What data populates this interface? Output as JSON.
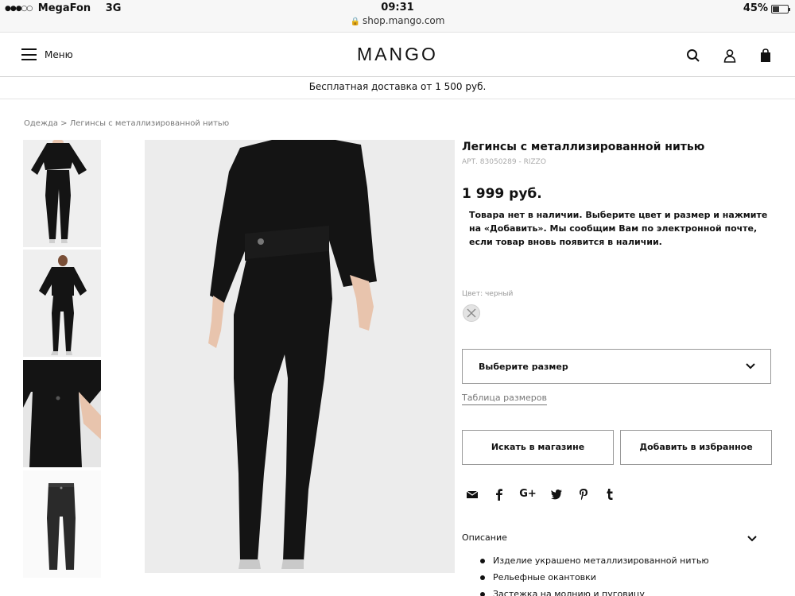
{
  "status_bar": {
    "carrier": "MegaFon",
    "network": "3G",
    "time": "09:31",
    "url": "shop.mango.com",
    "battery": "45%",
    "battery_level": 0.45
  },
  "header": {
    "menu_label": "Меню",
    "logo": "MANGO",
    "icons": [
      "search-icon",
      "user-icon",
      "bag-icon"
    ]
  },
  "promo": "Бесплатная доставка от 1 500 руб.",
  "breadcrumb": "Одежда > Легинсы с металлизированной нитью",
  "product": {
    "title": "Легинсы с металлизированной нитью",
    "ref": "АРТ. 83050289 - RIZZO",
    "price": "1 999 руб.",
    "stock_message": "Товара нет в наличии. Выберите цвет и размер и нажмите на «Добавить». Мы сообщим Вам по электронной почте, если товар вновь появится в наличии.",
    "color_label": "Цвет: черный",
    "size_placeholder": "Выберите размер",
    "size_chart": "Таблица размеров",
    "find_in_store": "Искать в магазине",
    "add_to_favorites": "Добавить в избранное"
  },
  "share": {
    "google_plus_label": "G+",
    "icons": [
      "mail-icon",
      "facebook-icon",
      "google-plus-icon",
      "twitter-icon",
      "pinterest-icon",
      "tumblr-icon"
    ]
  },
  "description": {
    "heading": "Описание",
    "items": [
      "Изделие украшено металлизированной нитью",
      "Рельефные окантовки",
      "Застежка на молнию и пуговицу"
    ]
  },
  "colors": {
    "garment": "#141414",
    "photo_bg": "#ececec",
    "skin": "#e8c4ad"
  }
}
